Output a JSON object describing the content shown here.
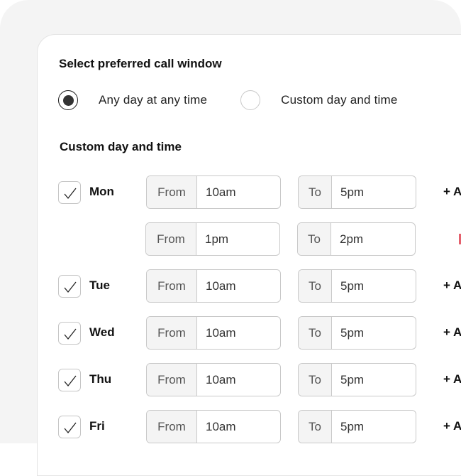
{
  "form": {
    "title": "Select preferred call window",
    "radio_options": [
      {
        "label": "Any day at any time",
        "selected": true
      },
      {
        "label": "Custom day and time",
        "selected": false
      }
    ],
    "custom_section_title": "Custom day and time",
    "schedule": [
      {
        "day": "Mon",
        "checked": true,
        "from_label": "From",
        "from": "10am",
        "to_label": "To",
        "to": "5pm",
        "action": "+ A"
      },
      {
        "day": "",
        "checked": null,
        "from_label": "From",
        "from": "1pm",
        "to_label": "To",
        "to": "2pm",
        "action": "remove"
      },
      {
        "day": "Tue",
        "checked": true,
        "from_label": "From",
        "from": "10am",
        "to_label": "To",
        "to": "5pm",
        "action": "+ A"
      },
      {
        "day": "Wed",
        "checked": true,
        "from_label": "From",
        "from": "10am",
        "to_label": "To",
        "to": "5pm",
        "action": "+ A"
      },
      {
        "day": "Thu",
        "checked": true,
        "from_label": "From",
        "from": "10am",
        "to_label": "To",
        "to": "5pm",
        "action": "+ A"
      },
      {
        "day": "Fri",
        "checked": true,
        "from_label": "From",
        "from": "10am",
        "to_label": "To",
        "to": "5pm",
        "action": "+ A"
      }
    ]
  },
  "icons": {
    "checkbox": "checkmark-icon",
    "remove": "remove-icon"
  },
  "colors": {
    "remove_accent": "#e4606d",
    "radio_selected": "#333333"
  }
}
